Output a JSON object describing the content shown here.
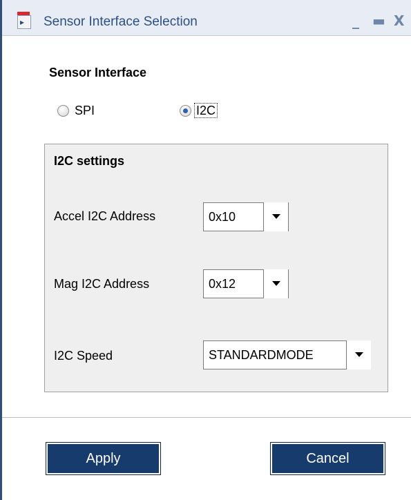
{
  "window": {
    "title": "Sensor Interface Selection",
    "controls": {
      "minimize": "_",
      "maximize": "▬",
      "close": "X"
    }
  },
  "interface": {
    "label": "Sensor  Interface",
    "options": [
      {
        "label": "SPI",
        "selected": false
      },
      {
        "label": "I2C",
        "selected": true
      }
    ]
  },
  "i2c_settings": {
    "title": "I2C settings",
    "fields": [
      {
        "label": "Accel I2C Address",
        "value": "0x10"
      },
      {
        "label": "Mag I2C Address",
        "value": "0x12"
      },
      {
        "label": "I2C Speed",
        "value": "STANDARDMODE"
      }
    ]
  },
  "buttons": {
    "apply": "Apply",
    "cancel": "Cancel"
  },
  "colors": {
    "title_text": "#2c4f86",
    "button_bg": "#173b6c",
    "radio_selected": "#2b5fb8"
  },
  "icons": {
    "app": "window-app-icon",
    "dropdown": "chevron-down-icon"
  }
}
